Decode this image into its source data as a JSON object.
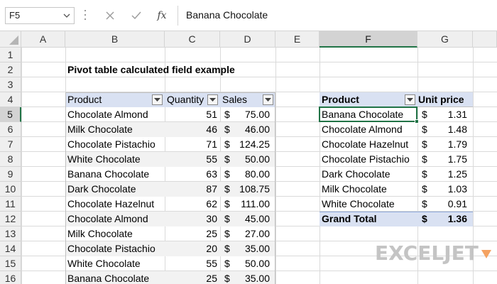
{
  "name_box": {
    "value": "F5"
  },
  "formula_bar": {
    "fx_label": "fx",
    "content": "Banana Chocolate"
  },
  "columns": [
    "A",
    "B",
    "C",
    "D",
    "E",
    "F",
    "G"
  ],
  "rows": [
    "1",
    "2",
    "3",
    "4",
    "5",
    "6",
    "7",
    "8",
    "9",
    "10",
    "11",
    "12",
    "13",
    "14",
    "15",
    "16"
  ],
  "active_cell": {
    "column": "F",
    "row": "5"
  },
  "title": "Pivot table calculated field example",
  "source_table": {
    "headers": [
      "Product",
      "Quantity",
      "Sales"
    ],
    "currency": "$",
    "rows": [
      {
        "product": "Chocolate Almond",
        "quantity": "51",
        "sales": "75.00"
      },
      {
        "product": "Milk Chocolate",
        "quantity": "46",
        "sales": "46.00"
      },
      {
        "product": "Chocolate Pistachio",
        "quantity": "71",
        "sales": "124.25"
      },
      {
        "product": "White Chocolate",
        "quantity": "55",
        "sales": "50.00"
      },
      {
        "product": "Banana Chocolate",
        "quantity": "63",
        "sales": "80.00"
      },
      {
        "product": "Dark Chocolate",
        "quantity": "87",
        "sales": "108.75"
      },
      {
        "product": "Chocolate Hazelnut",
        "quantity": "62",
        "sales": "111.00"
      },
      {
        "product": "Chocolate Almond",
        "quantity": "30",
        "sales": "45.00"
      },
      {
        "product": "Milk Chocolate",
        "quantity": "25",
        "sales": "27.00"
      },
      {
        "product": "Chocolate Pistachio",
        "quantity": "20",
        "sales": "35.00"
      },
      {
        "product": "White Chocolate",
        "quantity": "55",
        "sales": "50.00"
      },
      {
        "product": "Banana Chocolate",
        "quantity": "25",
        "sales": "35.00"
      }
    ]
  },
  "pivot_table": {
    "headers": [
      "Product",
      "Unit price"
    ],
    "currency": "$",
    "rows": [
      {
        "product": "Banana Chocolate",
        "unit_price": "1.31"
      },
      {
        "product": "Chocolate Almond",
        "unit_price": "1.48"
      },
      {
        "product": "Chocolate Hazelnut",
        "unit_price": "1.79"
      },
      {
        "product": "Chocolate Pistachio",
        "unit_price": "1.75"
      },
      {
        "product": "Dark Chocolate",
        "unit_price": "1.25"
      },
      {
        "product": "Milk Chocolate",
        "unit_price": "1.03"
      },
      {
        "product": "White Chocolate",
        "unit_price": "0.91"
      }
    ],
    "grand_total": {
      "label": "Grand Total",
      "unit_price": "1.36"
    }
  },
  "watermark": "EXCELJET",
  "colors": {
    "table_header_fill": "#d9e1f2",
    "banded_row_fill": "#f2f2f2",
    "selection_green": "#217346",
    "logo_orange": "#f4a261"
  }
}
